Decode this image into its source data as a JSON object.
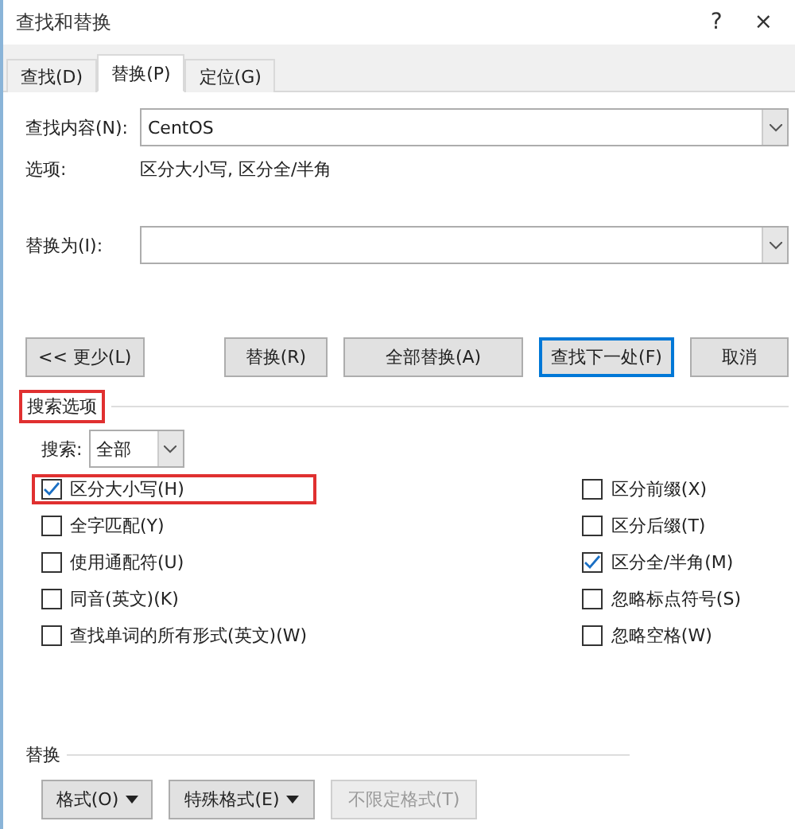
{
  "window": {
    "title": "查找和替换",
    "help": "?",
    "close": "×"
  },
  "tabs": [
    {
      "label": "查找(D)",
      "selected": false
    },
    {
      "label": "替换(P)",
      "selected": true
    },
    {
      "label": "定位(G)",
      "selected": false
    }
  ],
  "find": {
    "label": "查找内容(N):",
    "value": "CentOS"
  },
  "options": {
    "label": "选项:",
    "value": "区分大小写, 区分全/半角"
  },
  "replace": {
    "label": "替换为(I):"
  },
  "buttons": [
    {
      "label": "<< 更少(L)",
      "default": false
    },
    {
      "label": "替换(R)",
      "default": false
    },
    {
      "label": "全部替换(A)",
      "default": false
    },
    {
      "label": "查找下一处(F)",
      "default": true
    },
    {
      "label": "取消",
      "default": false
    }
  ],
  "search_options": {
    "title": "搜索选项",
    "highlighted": true,
    "search_label": "搜索:",
    "search_value": "全部"
  },
  "left_checks": [
    {
      "label": "区分大小写(H)",
      "checked": true,
      "highlighted": true
    },
    {
      "label": "全字匹配(Y)",
      "checked": false,
      "highlighted": false
    },
    {
      "label": "使用通配符(U)",
      "checked": false,
      "highlighted": false
    },
    {
      "label": "同音(英文)(K)",
      "checked": false,
      "highlighted": false
    },
    {
      "label": "查找单词的所有形式(英文)(W)",
      "checked": false,
      "highlighted": false
    }
  ],
  "right_checks": [
    {
      "label": "区分前缀(X)",
      "checked": false
    },
    {
      "label": "区分后缀(T)",
      "checked": false
    },
    {
      "label": "区分全/半角(M)",
      "checked": true
    },
    {
      "label": "忽略标点符号(S)",
      "checked": false
    },
    {
      "label": "忽略空格(W)",
      "checked": false
    }
  ],
  "replace_section": {
    "title": "替换",
    "buttons": [
      {
        "label": "格式(O)",
        "dropdown": true,
        "disabled": false
      },
      {
        "label": "特殊格式(E)",
        "dropdown": true,
        "disabled": false
      },
      {
        "label": "不限定格式(T)",
        "dropdown": false,
        "disabled": true
      }
    ]
  }
}
